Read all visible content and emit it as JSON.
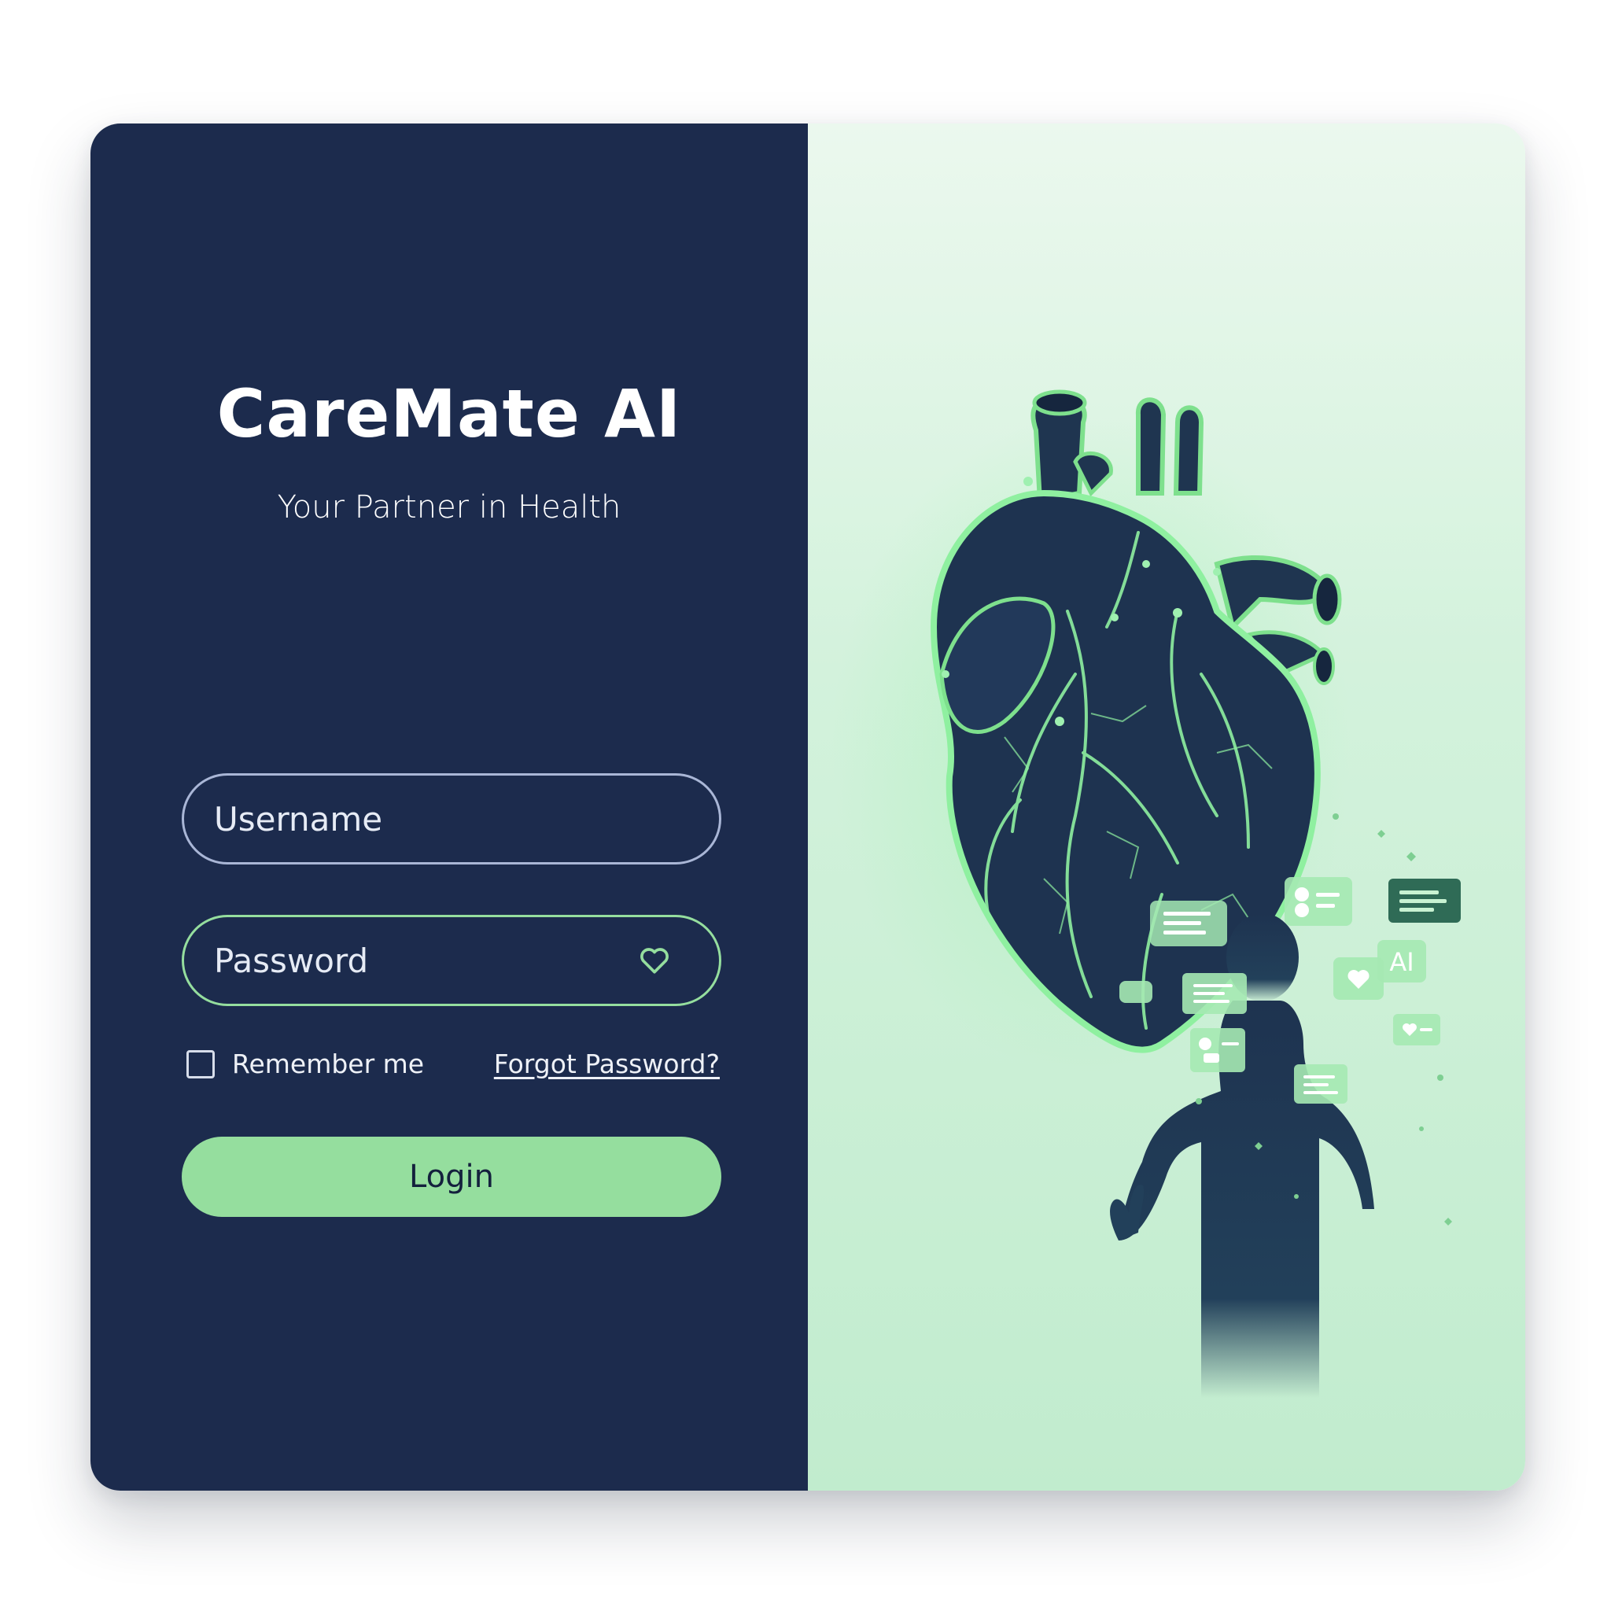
{
  "brand": {
    "title": "CareMate AI",
    "subtitle": "Your Partner in Health"
  },
  "form": {
    "username_placeholder": "Username",
    "password_placeholder": "Password",
    "remember_label": "Remember me",
    "remember_checked": false,
    "forgot_label": "Forgot Password?",
    "login_label": "Login"
  },
  "illustration": {
    "ai_badge": "AI",
    "icons": [
      "heart-anatomy",
      "person-silhouette",
      "chat-bubble",
      "profile-card",
      "heart-badge"
    ]
  },
  "colors": {
    "panel_dark": "#1c2b4d",
    "accent_green": "#95de9e",
    "panel_light": "#d3f2dc"
  }
}
